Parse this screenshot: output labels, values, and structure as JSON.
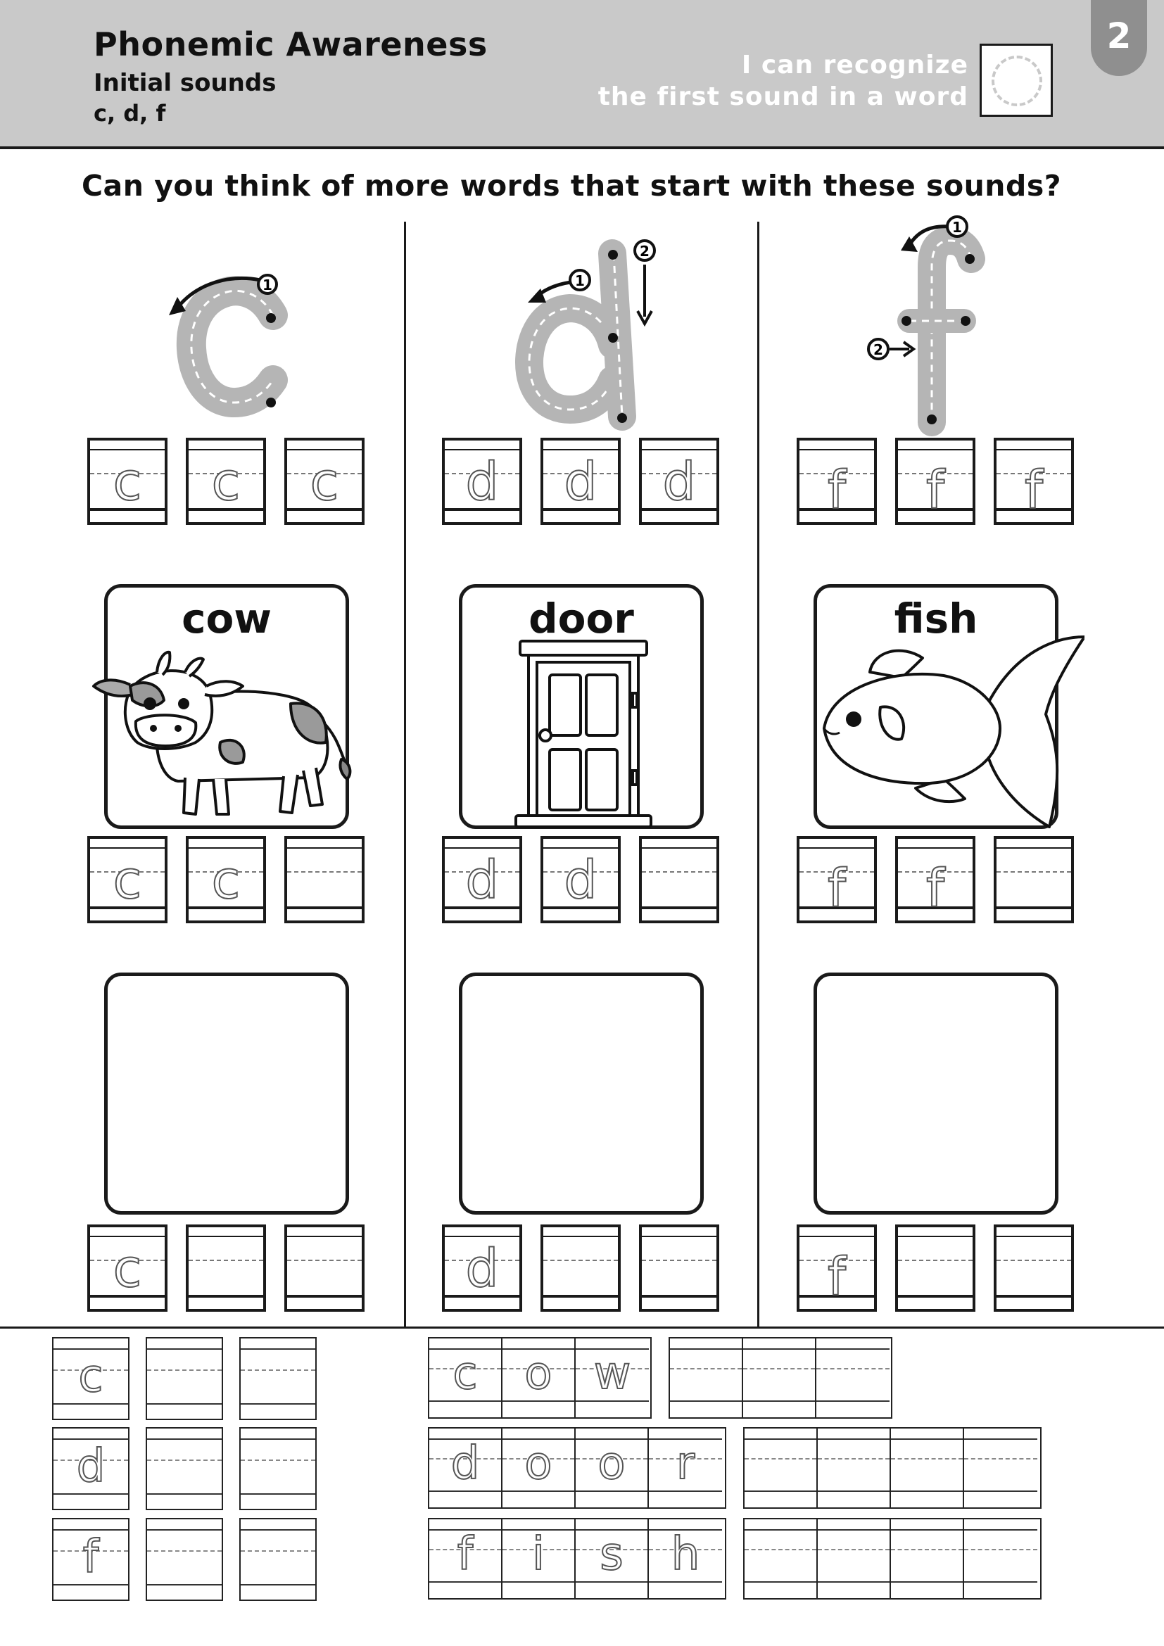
{
  "header": {
    "title": "Phonemic Awareness",
    "subtitle": "Initial sounds",
    "letters": "c, d, f",
    "goal_line1": "I can recognize",
    "goal_line2": "the first sound in a word",
    "page_number": "2"
  },
  "question": "Can you think of more words that start with these sounds?",
  "columns": [
    {
      "letter": "c",
      "word": "cow"
    },
    {
      "letter": "d",
      "word": "door"
    },
    {
      "letter": "f",
      "word": "fish"
    }
  ],
  "stroke_numbers": {
    "one": "1",
    "two": "2"
  },
  "bottom": {
    "words": [
      [
        "c",
        "o",
        "w"
      ],
      [
        "d",
        "o",
        "o",
        "r"
      ],
      [
        "f",
        "i",
        "s",
        "h"
      ]
    ]
  },
  "colors": {
    "header_bg": "#c9c9c9",
    "page_tab": "#8f8f8f",
    "ink": "#1a1a1a",
    "tracer_gray": "#b5b5b5"
  },
  "icons": [
    "cow-illustration",
    "door-illustration",
    "fish-illustration",
    "stroke-arrow-icon",
    "goal-checkbox-icon"
  ]
}
